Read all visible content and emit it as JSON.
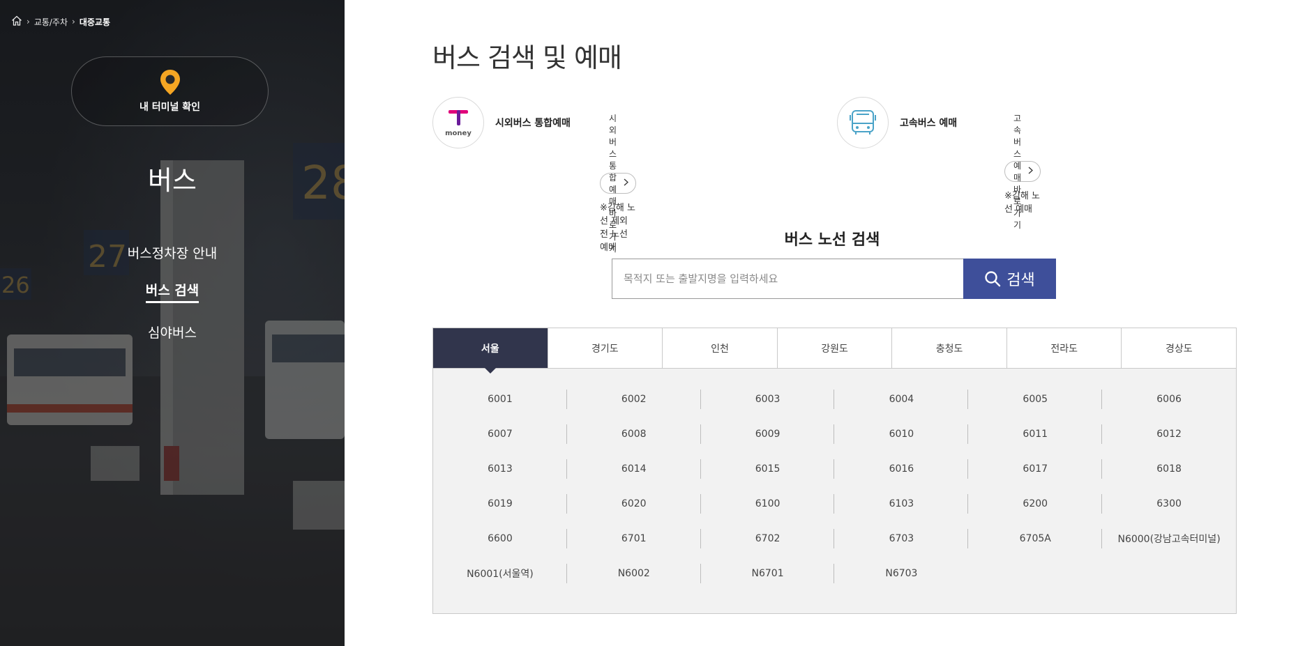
{
  "breadcrumb": {
    "home_icon": "home-icon",
    "items": [
      "교통/주차",
      "대중교통"
    ]
  },
  "sidebar": {
    "terminal_button": "내 터미널 확인",
    "section_title": "버스",
    "menu": [
      {
        "label": "버스정차장 안내",
        "active": false
      },
      {
        "label": "버스 검색",
        "active": true
      },
      {
        "label": "심야버스",
        "active": false
      }
    ]
  },
  "main": {
    "title": "버스 검색 및 예매",
    "booking": [
      {
        "logo": "tmoney-logo",
        "name": "시외버스 통합예매",
        "link": "시외버스 통합예매 바로가기",
        "note": "※김해 노선 제외 전 노선 예매"
      },
      {
        "logo": "bus-icon",
        "name": "고속버스 예매",
        "link": "고속버스 예매 바로가기",
        "note": "※김해 노선 예매"
      }
    ],
    "search": {
      "heading": "버스 노선 검색",
      "placeholder": "목적지 또는 출발지명을 입력하세요",
      "button": "검색"
    },
    "regions": [
      "서울",
      "경기도",
      "인천",
      "강원도",
      "충청도",
      "전라도",
      "경상도"
    ],
    "active_region": "서울",
    "routes": [
      "6001",
      "6002",
      "6003",
      "6004",
      "6005",
      "6006",
      "6007",
      "6008",
      "6009",
      "6010",
      "6011",
      "6012",
      "6013",
      "6014",
      "6015",
      "6016",
      "6017",
      "6018",
      "6019",
      "6020",
      "6100",
      "6103",
      "6200",
      "6300",
      "6600",
      "6701",
      "6702",
      "6703",
      "6705A",
      "N6000(강남고속터미널)",
      "N6001(서울역)",
      "N6002",
      "N6701",
      "N6703"
    ]
  },
  "colors": {
    "accent": "#3e4f9a",
    "active_tab": "#31354c",
    "pin": "#f5a623",
    "bus_icon": "#4aa3c8"
  }
}
